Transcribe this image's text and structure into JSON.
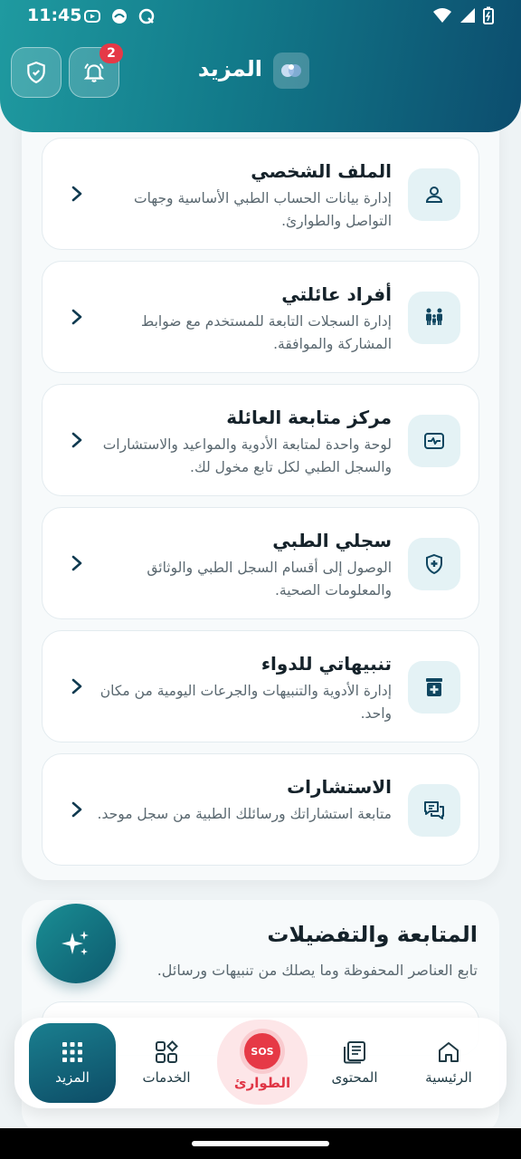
{
  "status_bar": {
    "time": "11:45"
  },
  "header": {
    "title": "المزيد",
    "notification_count": "2"
  },
  "menu": [
    {
      "title": "الملف الشخصي",
      "desc": "إدارة بيانات الحساب الطبي الأساسية وجهات التواصل والطوارئ.",
      "icon": "person-icon"
    },
    {
      "title": "أفراد عائلتي",
      "desc": "إدارة السجلات التابعة للمستخدم مع ضوابط المشاركة والموافقة.",
      "icon": "family-icon"
    },
    {
      "title": "مركز متابعة العائلة",
      "desc": "لوحة واحدة لمتابعة الأدوية والمواعيد والاستشارات والسجل الطبي لكل تابع مخول لك.",
      "icon": "monitor-pulse-icon"
    },
    {
      "title": "سجلي الطبي",
      "desc": "الوصول إلى أقسام السجل الطبي والوثائق والمعلومات الصحية.",
      "icon": "shield-plus-icon"
    },
    {
      "title": "تنبيهاتي للدواء",
      "desc": "إدارة الأدوية والتنبيهات والجرعات اليومية من مكان واحد.",
      "icon": "medicine-icon"
    },
    {
      "title": "الاستشارات",
      "desc": "متابعة استشاراتك ورسائلك الطبية من سجل موحد.",
      "icon": "chat-icon"
    }
  ],
  "section2": {
    "title": "المتابعة والتفضيلات",
    "subtitle": "تابع العناصر المحفوظة وما يصلك من تنبيهات ورسائل."
  },
  "bottom_nav": {
    "more": "المزيد",
    "services": "الخدمات",
    "emergency": "الطوارئ",
    "sos": "SOS",
    "content": "المحتوى",
    "home": "الرئيسية"
  },
  "colors": {
    "primary": "#127a8a",
    "primary_dark": "#0c4d6e",
    "emergency": "#e63946",
    "icon_bg": "#e4f2f5"
  }
}
